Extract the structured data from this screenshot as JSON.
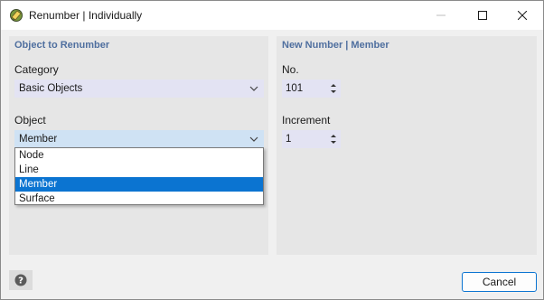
{
  "window": {
    "title": "Renumber | Individually",
    "icon": "renumber-app-icon"
  },
  "left_panel": {
    "title": "Object to Renumber",
    "category_label": "Category",
    "category_value": "Basic Objects",
    "object_label": "Object",
    "object_value": "Member",
    "object_options": [
      "Node",
      "Line",
      "Member",
      "Surface"
    ],
    "object_selected_index": 2
  },
  "right_panel": {
    "title": "New Number | Member",
    "no_label": "No.",
    "no_value": "101",
    "increment_label": "Increment",
    "increment_value": "1"
  },
  "footer": {
    "help_icon": "help-icon",
    "cancel_label": "Cancel"
  },
  "colors": {
    "panel_title": "#4f6f9f",
    "selection": "#0b74d1",
    "field_bg": "#e3e3f3",
    "active_field_bg": "#cfe2f4"
  }
}
